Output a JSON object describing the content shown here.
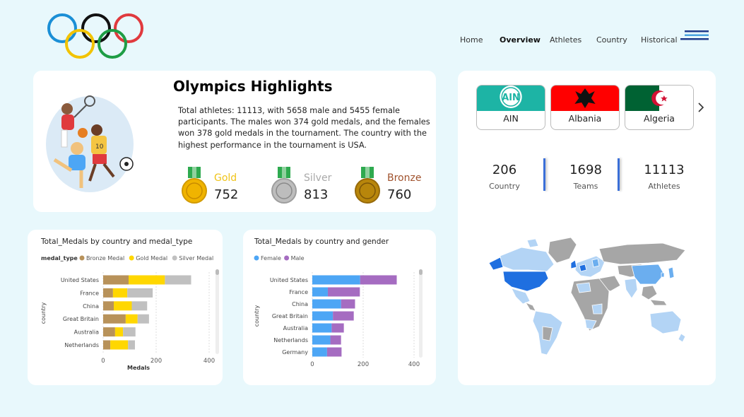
{
  "nav": {
    "items": [
      "Home",
      "Overview",
      "Athletes",
      "Country",
      "Historical"
    ],
    "active": "Overview"
  },
  "highlights": {
    "title": "Olympics Highlights",
    "text": "Total athletes: 11113, with 5658 male and 5455 female participants. The males won 374 gold medals, and the females won 378 gold medals in the tournament. The country with the highest performance in the tournament is USA.",
    "medals": [
      {
        "label": "Gold",
        "value": "752",
        "color": "#f0c419"
      },
      {
        "label": "Silver",
        "value": "813",
        "color": "#a9a9a9"
      },
      {
        "label": "Bronze",
        "value": "760",
        "color": "#a0522d"
      }
    ]
  },
  "countries": {
    "tiles": [
      {
        "name": "AIN",
        "flag_text": "AIN",
        "color": "#1db4a5"
      },
      {
        "name": "Albania",
        "color": "#ff0000"
      },
      {
        "name": "Algeria",
        "color": "#006233"
      }
    ]
  },
  "kpis": [
    {
      "value": "206",
      "label": "Country"
    },
    {
      "value": "1698",
      "label": "Teams"
    },
    {
      "value": "11113",
      "label": "Athletes"
    }
  ],
  "chart_data": [
    {
      "type": "bar",
      "orientation": "horizontal",
      "stacked": true,
      "title": "Total_Medals by country and medal_type",
      "legend_title": "medal_type",
      "xlabel": "Medals",
      "ylabel": "country",
      "categories": [
        "United States",
        "France",
        "China",
        "Great Britain",
        "Australia",
        "Netherlands"
      ],
      "series": [
        {
          "name": "Bronze Medal",
          "color": "#b8925a",
          "values": [
            96,
            37,
            40,
            85,
            45,
            27
          ]
        },
        {
          "name": "Gold Medal",
          "color": "#ffd700",
          "values": [
            137,
            54,
            68,
            45,
            30,
            67
          ]
        },
        {
          "name": "Silver Medal",
          "color": "#c0c0c0",
          "values": [
            99,
            96,
            58,
            43,
            47,
            26
          ]
        }
      ],
      "xticks": [
        "0",
        "200",
        "400"
      ],
      "xlim": [
        0,
        400
      ],
      "grid": true,
      "legend_position": "top-left"
    },
    {
      "type": "bar",
      "orientation": "horizontal",
      "stacked": true,
      "title": "Total_Medals by country and gender",
      "ylabel": "country",
      "categories": [
        "United States",
        "France",
        "China",
        "Great Britain",
        "Australia",
        "Netherlands",
        "Germany"
      ],
      "series": [
        {
          "name": "Female",
          "color": "#4da6f5",
          "values": [
            188,
            61,
            113,
            81,
            76,
            71,
            58
          ]
        },
        {
          "name": "Male",
          "color": "#a56cc1",
          "values": [
            144,
            126,
            55,
            82,
            48,
            42,
            57
          ]
        }
      ],
      "xticks": [
        "0",
        "200",
        "400"
      ],
      "xlim": [
        0,
        400
      ],
      "grid": true,
      "legend_position": "top-left"
    }
  ]
}
